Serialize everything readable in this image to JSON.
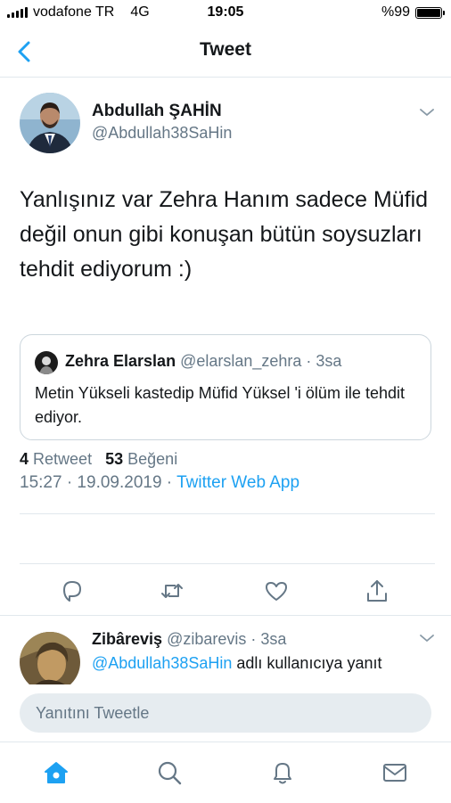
{
  "status_bar": {
    "carrier": "vodafone TR",
    "network": "4G",
    "time": "19:05",
    "battery": "%99",
    "battery_level": 0.99
  },
  "nav": {
    "back_icon": "chevron-left-icon",
    "title": "Tweet"
  },
  "tweet": {
    "author_name": "Abdullah ŞAHİN",
    "author_handle": "@Abdullah38SaHin",
    "text": "Yanlışınız var Zehra Hanım sadece Müfid değil onun gibi konuşan bütün soysuzları tehdit ediyorum :)",
    "quote": {
      "name": "Zehra Elarslan",
      "meta": "@elarslan_zehra · 3sa",
      "text": "Metin Yükseli kastedip Müfid Yüksel 'i ölüm ile tehdit ediyor."
    },
    "timestamp": "15:27 · 19.09.2019 · ",
    "source": "Twitter Web App",
    "stats": {
      "retweet_count": "4",
      "retweet_label": "Retweet",
      "like_count": "53",
      "like_label": "Beğeni"
    },
    "actions": [
      "reply-icon",
      "retweet-icon",
      "like-icon",
      "share-icon"
    ]
  },
  "reply": {
    "name": "Zibâreviş",
    "meta": "@zibarevis · 3sa",
    "mention": "@Abdullah38SaHin",
    "context_suffix": " adlı kullanıcıya yanıt"
  },
  "compose": {
    "placeholder": "Yanıtını Tweetle"
  },
  "tab_bar": [
    "home-icon",
    "search-icon",
    "notifications-icon",
    "messages-icon"
  ],
  "colors": {
    "accent": "#1da1f2",
    "secondary_text": "#657786",
    "border": "#e1e8ed"
  }
}
